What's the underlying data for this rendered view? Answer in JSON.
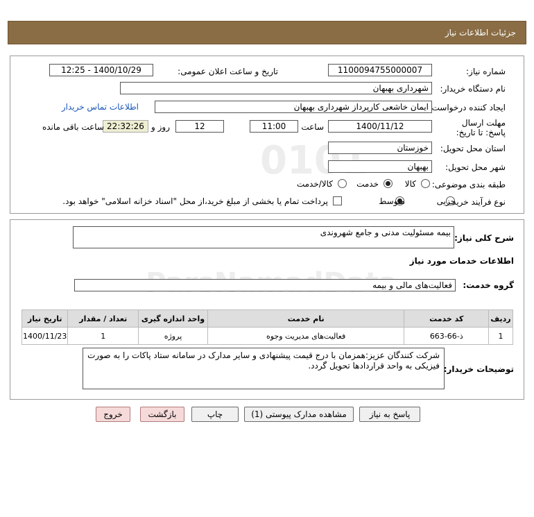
{
  "header": {
    "title": "جزئیات اطلاعات نیاز"
  },
  "form": {
    "need_number_label": "شماره نیاز:",
    "need_number": "1100094755000007",
    "announce_label": "تاریخ و ساعت اعلان عمومی:",
    "announce_value": "1400/10/29 - 12:25",
    "buyer_org_label": "نام دستگاه خریدار:",
    "buyer_org": "شهرداری بهبهان",
    "requester_label": "ایجاد کننده درخواست:",
    "requester": "ایمان خاشعی کارپرداز شهرداری بهبهان",
    "contact_link": "اطلاعات تماس خریدار",
    "deadline_label": "مهلت ارسال پاسخ: تا تاریخ:",
    "deadline_date": "1400/11/12",
    "hour_label": "ساعت",
    "deadline_hour": "11:00",
    "days_value": "12",
    "days_label": "روز و",
    "remaining_time": "22:32:26",
    "remaining_label": "ساعت باقی مانده",
    "province_label": "استان محل تحویل:",
    "province": "خوزستان",
    "city_label": "شهر محل تحویل:",
    "city": "بهبهان",
    "category_label": "طبقه بندی موضوعی:",
    "category_options": [
      "کالا",
      "خدمت",
      "کالا/خدمت"
    ],
    "category_selected": "خدمت",
    "purchase_type_label": "نوع فرآیند خرید :",
    "purchase_options": [
      "جزیی",
      "متوسط"
    ],
    "purchase_selected": "متوسط",
    "payment_note": "پرداخت تمام یا بخشی از مبلغ خرید،از محل \"اسناد خزانه اسلامی\" خواهد بود."
  },
  "details": {
    "summary_label": "شرح کلی نیاز:",
    "summary": "بیمه مسئولیت مدنی و جامع شهروندی",
    "services_heading": "اطلاعات خدمات مورد نیاز",
    "service_group_label": "گروه خدمت:",
    "service_group": "فعالیت‌های مالی و بیمه",
    "table": {
      "headers": [
        "ردیف",
        "کد خدمت",
        "نام خدمت",
        "واحد اندازه گیری",
        "تعداد / مقدار",
        "تاریخ نیاز"
      ],
      "rows": [
        [
          "1",
          "ذ-66-663",
          "فعالیت‌های مدیریت وجوه",
          "پروژه",
          "1",
          "1400/11/23"
        ]
      ]
    },
    "buyer_notes_label": "توضیحات خریدار:",
    "buyer_notes": "شرکت کنندگان عزیز:همزمان با درج قیمت پیشنهادی و سایر مدارک در سامانه ستاد پاکات را به صورت فیزیکی به واحد قراردادها تحویل گردد."
  },
  "buttons": {
    "reply": "پاسخ به نیاز",
    "attachments": "مشاهده مدارک پیوستی (1)",
    "print": "چاپ",
    "back": "بازگشت",
    "exit": "خروج"
  }
}
